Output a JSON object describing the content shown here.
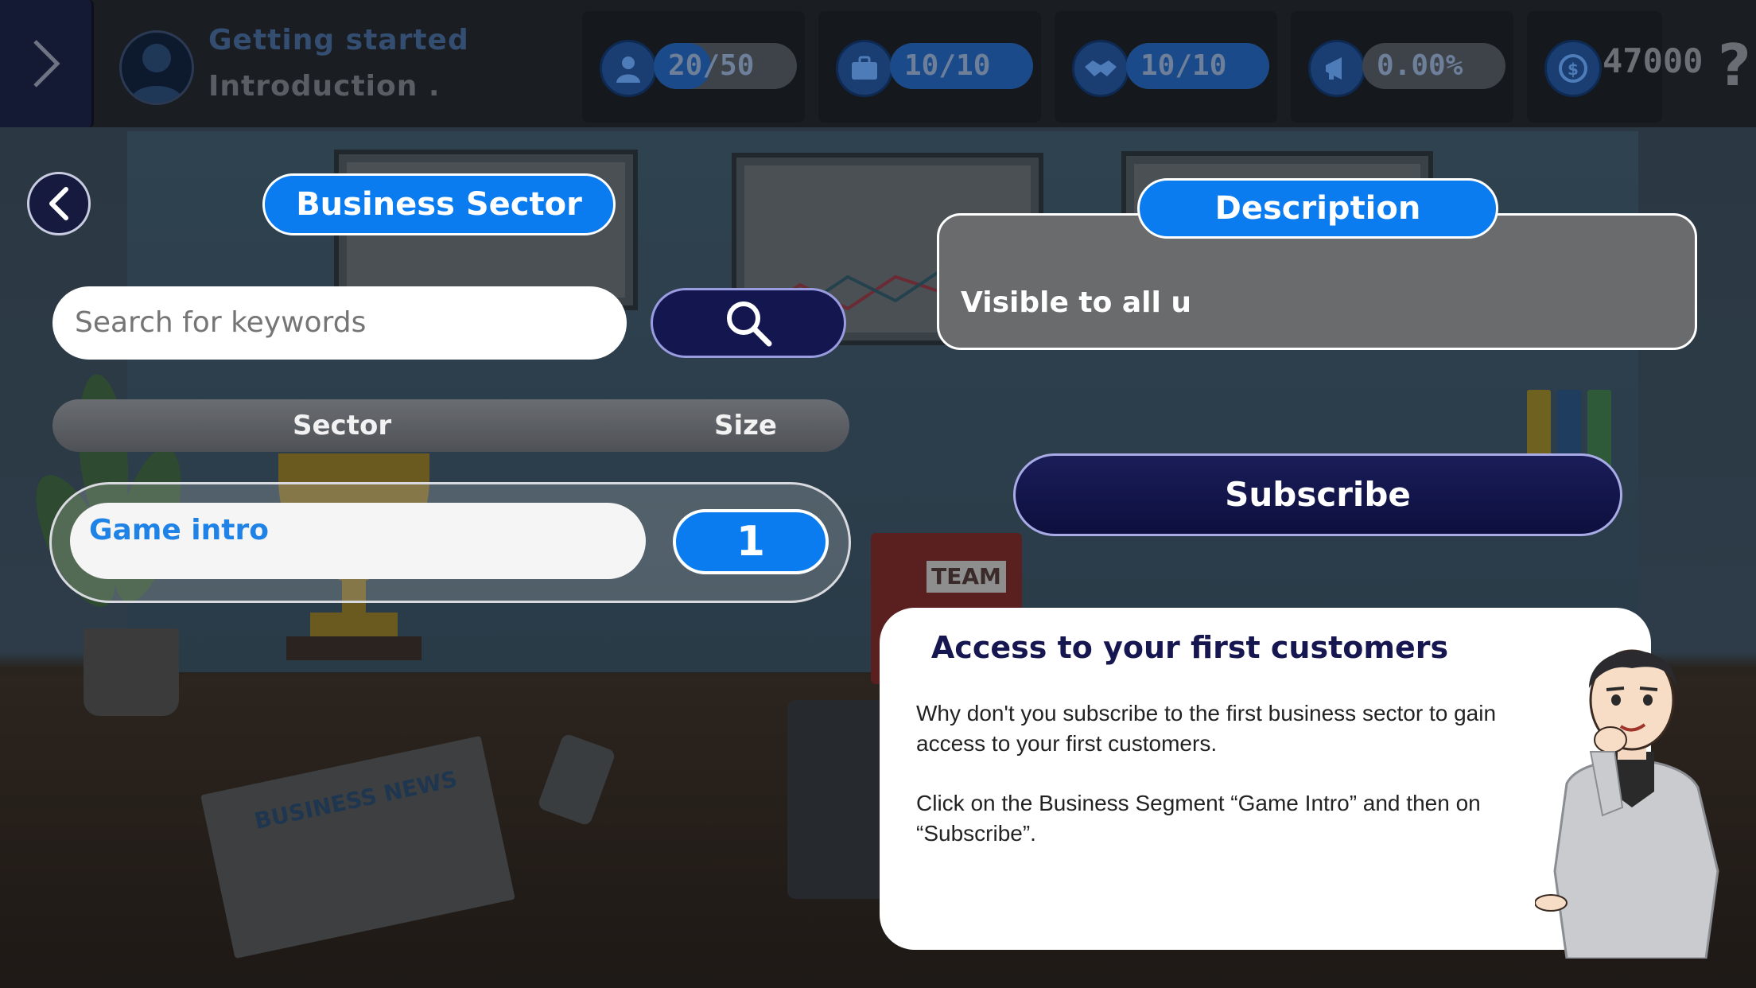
{
  "header": {
    "level_title": "Getting started",
    "level_subtitle": "Introduction .",
    "stats": [
      {
        "icon": "employee-icon",
        "value": "20/50",
        "fill": 0.4
      },
      {
        "icon": "briefcase-icon",
        "value": "10/10",
        "fill": 1.0
      },
      {
        "icon": "handshake-icon",
        "value": "10/10",
        "fill": 1.0
      },
      {
        "icon": "megaphone-icon",
        "value": "0.00%",
        "fill": 0.0
      }
    ],
    "coins": "47000",
    "help": "?"
  },
  "sector_panel": {
    "title": "Business Sector",
    "search_placeholder": "Search for keywords",
    "columns": [
      "Sector",
      "Size"
    ],
    "rows": [
      {
        "sector": "Game intro",
        "size": "1"
      }
    ]
  },
  "description_panel": {
    "title": "Description",
    "text": "Visible to all u"
  },
  "subscribe_label": "Subscribe",
  "tutorial": {
    "title": "Access to your first customers",
    "paragraph1": "Why don't you subscribe to the first business sector to gain access to your first customers.",
    "paragraph2": "Click on the Business Segment “Game Intro” and then on “Subscribe”."
  },
  "scene": {
    "team_box_label": "TEAM",
    "newspaper_label": "BUSINESS NEWS"
  },
  "colors": {
    "accent": "#0b7cf0",
    "navy": "#141650",
    "dialog_title": "#161650"
  }
}
